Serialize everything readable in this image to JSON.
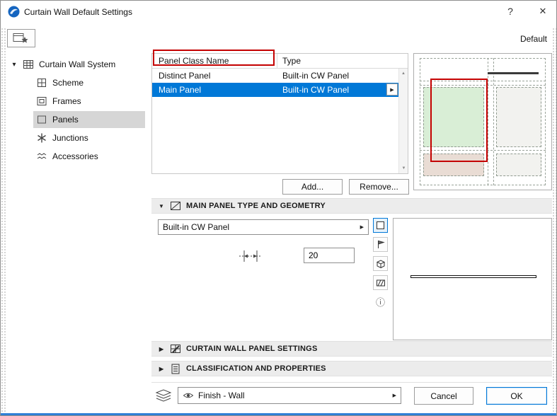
{
  "window": {
    "title": "Curtain Wall Default Settings",
    "help_glyph": "?",
    "close_glyph": "✕"
  },
  "favorites": {
    "default_label": "Default"
  },
  "glyphs": {
    "tree_expander": "▾",
    "section_open": "▼",
    "section_closed": "▶",
    "menu_arrow": "▶",
    "scroll_up": "▲",
    "scroll_down": "▼",
    "info": "ⓘ"
  },
  "tree": {
    "items": [
      {
        "label": "Curtain Wall System"
      },
      {
        "label": "Scheme"
      },
      {
        "label": "Frames"
      },
      {
        "label": "Panels"
      },
      {
        "label": "Junctions"
      },
      {
        "label": "Accessories"
      }
    ]
  },
  "panel_table": {
    "columns": {
      "name": "Panel Class Name",
      "type": "Type"
    },
    "rows": [
      {
        "name": "Distinct Panel",
        "type": "Built-in CW Panel"
      },
      {
        "name": "Main Panel",
        "type": "Built-in CW Panel"
      }
    ],
    "add_label": "Add...",
    "remove_label": "Remove..."
  },
  "sections": {
    "main_panel_geometry": {
      "title": "MAIN PANEL TYPE AND GEOMETRY",
      "panel_type_value": "Built-in CW Panel",
      "thickness_value": "20"
    },
    "cw_panel_settings": {
      "title": "CURTAIN WALL PANEL SETTINGS"
    },
    "classification": {
      "title": "CLASSIFICATION AND PROPERTIES"
    }
  },
  "footer": {
    "layer_value": "Finish - Wall",
    "cancel_label": "Cancel",
    "ok_label": "OK"
  },
  "colors": {
    "accent": "#0078d7",
    "selection": "#0078d7",
    "annotation": "#c40000",
    "panel_green": "#d9eed6",
    "panel_pink": "#e9dcd4"
  }
}
